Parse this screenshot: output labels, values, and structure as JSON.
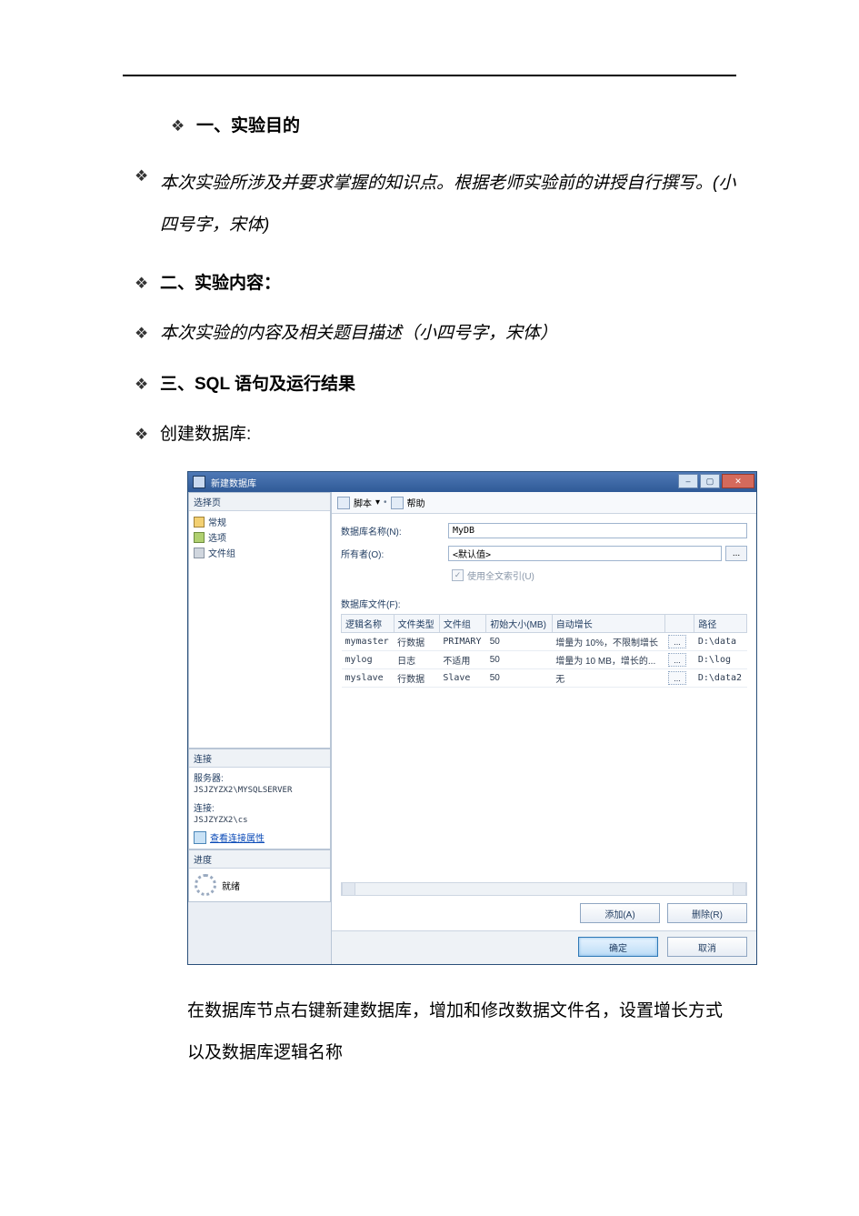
{
  "doc": {
    "sec1_title": "一、实验目的",
    "sec1_body": "本次实验所涉及并要求掌握的知识点。根据老师实验前的讲授自行撰写。(小四号字，宋体)",
    "sec2_title": "二、实验内容：",
    "sec2_body": "本次实验的内容及相关题目描述（小四号字，宋体）",
    "sec3_title": "三、SQL 语句及运行结果",
    "sec3_action": "创建数据库:",
    "footer_para": "在数据库节点右键新建数据库，增加和修改数据文件名，设置增长方式以及数据库逻辑名称",
    "bullet": "❖"
  },
  "win": {
    "title": "新建数据库",
    "ctrl_min": "–",
    "ctrl_max": "▢",
    "ctrl_close": "✕",
    "nav": {
      "head": "选择页",
      "items": [
        "常规",
        "选项",
        "文件组"
      ]
    },
    "conn": {
      "head": "连接",
      "server_lbl": "服务器:",
      "server_val": "JSJZYZX2\\MYSQLSERVER",
      "conn_lbl": "连接:",
      "conn_val": "JSJZYZX2\\cs",
      "link": "查看连接属性"
    },
    "prog": {
      "head": "进度",
      "text": "就绪"
    },
    "toolbar": {
      "script": "脚本",
      "dropdown": "▾",
      "help": "帮助"
    },
    "form": {
      "name_lbl": "数据库名称(N):",
      "name_val": "MyDB",
      "owner_lbl": "所有者(O):",
      "owner_val": "<默认值>",
      "owner_btn": "...",
      "fulltext_chk": "✓",
      "fulltext_lbl": "使用全文索引(U)",
      "files_lbl": "数据库文件(F):"
    },
    "grid": {
      "cols": [
        "逻辑名称",
        "文件类型",
        "文件组",
        "初始大小(MB)",
        "自动增长",
        "",
        "路径"
      ],
      "rows": [
        {
          "name": "mymaster",
          "type": "行数据",
          "group": "PRIMARY",
          "size": "50",
          "grow": "增量为 10%，不限制增长",
          "ell": "...",
          "path": "D:\\data"
        },
        {
          "name": "mylog",
          "type": "日志",
          "group": "不适用",
          "size": "50",
          "grow": "增量为 10 MB，增长的...",
          "ell": "...",
          "path": "D:\\log"
        },
        {
          "name": "myslave",
          "type": "行数据",
          "group": "Slave",
          "size": "50",
          "grow": "无",
          "ell": "...",
          "path": "D:\\data2"
        }
      ]
    },
    "actions": {
      "add": "添加(A)",
      "remove": "删除(R)",
      "ok": "确定",
      "cancel": "取消"
    }
  }
}
